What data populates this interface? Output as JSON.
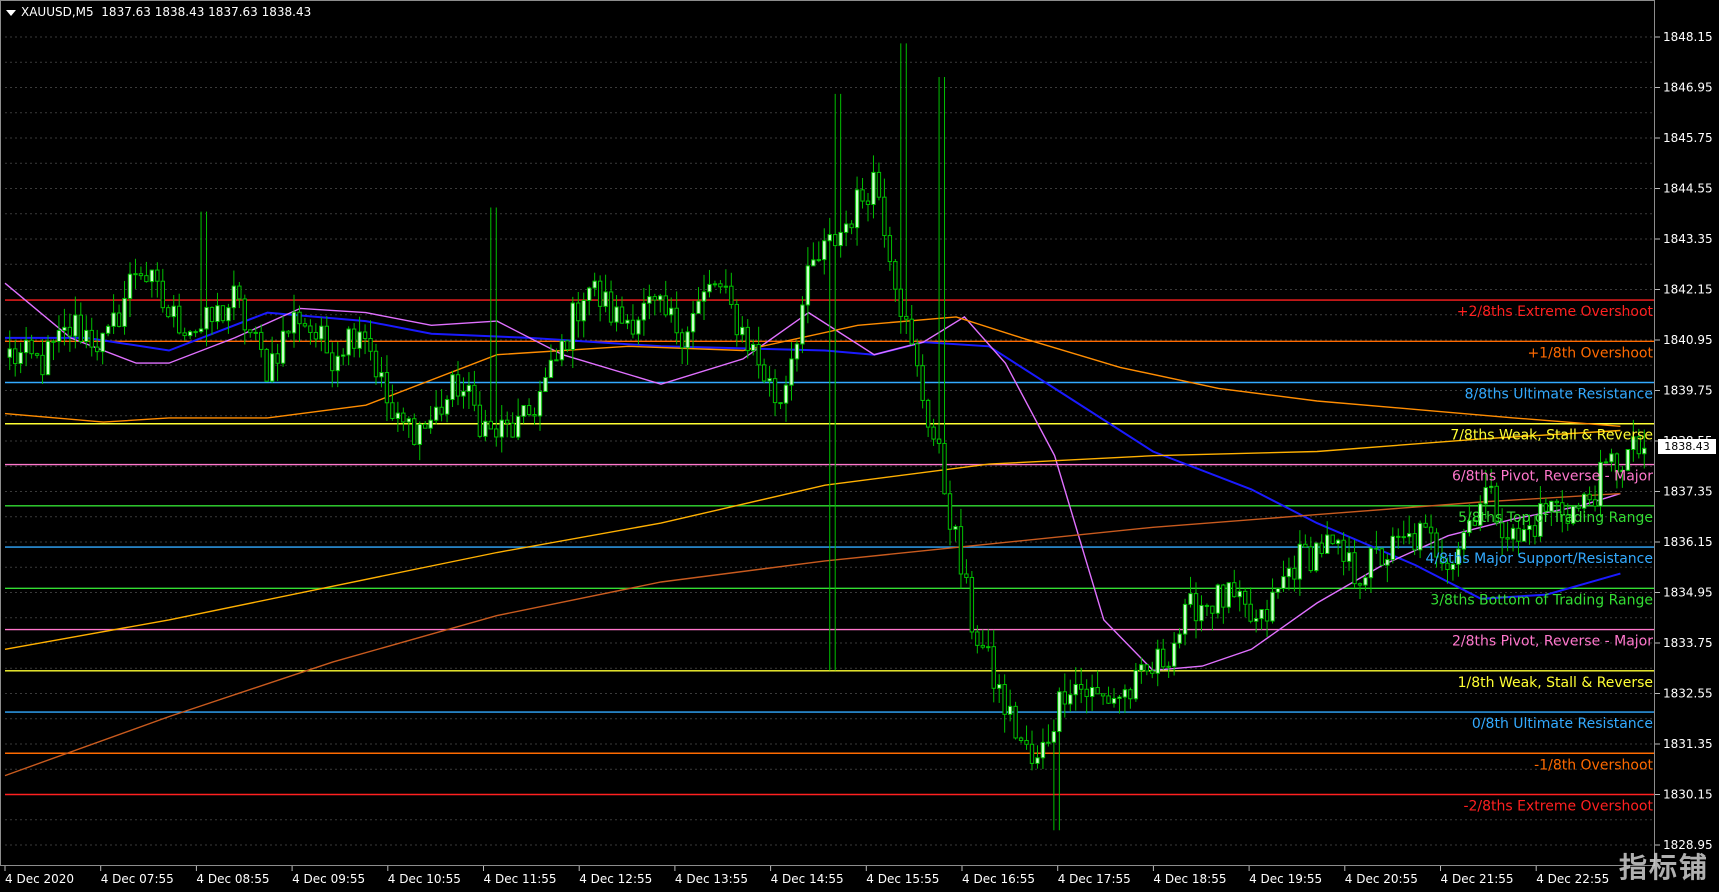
{
  "header": {
    "symbol": "XAUUSD,M5",
    "ohlc": "1837.63 1838.43 1837.63 1838.43"
  },
  "current_price_label": "1838.43",
  "watermark_text": "指标铺",
  "colors": {
    "background": "#000000",
    "bull_candle": "#ccffcc",
    "bear_candle": "#000000",
    "wick": "#00c000",
    "ma_blue": "#1a1aff",
    "ma_violet": "#e070ff",
    "ma_orange": "#ff8c00",
    "ma_gold": "#ffb000",
    "ma_brown": "#c85a1e"
  },
  "chart_data": {
    "type": "candlestick",
    "price_axis": {
      "ylim": [
        1828.95,
        1848.15
      ],
      "ticks": [
        "1848.15",
        "1846.95",
        "1845.75",
        "1844.55",
        "1843.35",
        "1842.15",
        "1840.95",
        "1839.75",
        "1838.55",
        "1837.35",
        "1836.15",
        "1834.95",
        "1833.75",
        "1832.55",
        "1831.35",
        "1830.15",
        "1828.95"
      ]
    },
    "time_axis": {
      "labels": [
        "4 Dec 2020",
        "4 Dec 07:55",
        "4 Dec 08:55",
        "4 Dec 09:55",
        "4 Dec 10:55",
        "4 Dec 11:55",
        "4 Dec 12:55",
        "4 Dec 13:55",
        "4 Dec 14:55",
        "4 Dec 15:55",
        "4 Dec 16:55",
        "4 Dec 17:55",
        "4 Dec 18:55",
        "4 Dec 19:55",
        "4 Dec 20:55",
        "4 Dec 21:55",
        "4 Dec 22:55"
      ]
    },
    "murrey_levels": [
      {
        "label": "+2/8ths Extreme Overshoot",
        "price": 1841.9,
        "color": "#ff2020"
      },
      {
        "label": "+1/8th Overshoot",
        "price": 1840.92,
        "color": "#ff6a00"
      },
      {
        "label": "8/8ths Ultimate Resistance",
        "price": 1839.94,
        "color": "#33aaff"
      },
      {
        "label": "7/8ths Weak, Stall & Reverse",
        "price": 1838.96,
        "color": "#ffff33"
      },
      {
        "label": "6/8ths Pivot, Reverse - Major",
        "price": 1837.99,
        "color": "#ff77cc"
      },
      {
        "label": "5/8ths Top of Trading Range",
        "price": 1837.01,
        "color": "#33dd33"
      },
      {
        "label": "4/8ths Major Support/Resistance",
        "price": 1836.03,
        "color": "#33aaff"
      },
      {
        "label": "3/8ths Bottom of Trading Range",
        "price": 1835.05,
        "color": "#33dd33"
      },
      {
        "label": "2/8ths Pivot, Reverse - Major",
        "price": 1834.07,
        "color": "#ff77cc"
      },
      {
        "label": "1/8th Weak, Stall & Reverse",
        "price": 1833.09,
        "color": "#ffff33"
      },
      {
        "label": "0/8th Ultimate Resistance",
        "price": 1832.11,
        "color": "#33aaff"
      },
      {
        "label": "-1/8th Overshoot",
        "price": 1831.13,
        "color": "#ff6a00"
      },
      {
        "label": "-2/8ths Extreme Overshoot",
        "price": 1830.15,
        "color": "#ff2020"
      }
    ],
    "anchors": [
      1840.6,
      1840.4,
      1841.3,
      1840.8,
      1842.8,
      1841.5,
      1841.2,
      1841.9,
      1840.3,
      1841.6,
      1840.6,
      1841.4,
      1838.9,
      1838.9,
      1839.9,
      1838.7,
      1838.9,
      1840.3,
      1842.3,
      1841.4,
      1841.7,
      1841.2,
      1842.3,
      1841.0,
      1839.4,
      1842.6,
      1843.6,
      1844.9,
      1841.1,
      1838.1,
      1834.3,
      1832.3,
      1830.7,
      1832.9,
      1832.4,
      1832.6,
      1833.4,
      1834.7,
      1834.8,
      1834.1,
      1835.6,
      1836.1,
      1835.4,
      1835.9,
      1836.3,
      1835.8,
      1837.4,
      1836.1,
      1837.0,
      1836.9,
      1838.0,
      1838.4
    ],
    "extremes": [
      {
        "t": 0.502,
        "low": 1833.1
      },
      {
        "t": 0.506,
        "high": 1846.8
      },
      {
        "t": 0.547,
        "high": 1848.0
      },
      {
        "t": 0.571,
        "high": 1847.2
      },
      {
        "t": 0.64,
        "low": 1829.3
      },
      {
        "t": 0.296,
        "high": 1844.1
      },
      {
        "t": 0.12,
        "high": 1844.0
      }
    ],
    "moving_averages": [
      {
        "key": "blue",
        "points": [
          [
            0,
            1841.0
          ],
          [
            0.05,
            1841.0
          ],
          [
            0.1,
            1840.7
          ],
          [
            0.16,
            1841.6
          ],
          [
            0.22,
            1841.4
          ],
          [
            0.26,
            1841.1
          ],
          [
            0.32,
            1841.0
          ],
          [
            0.4,
            1840.8
          ],
          [
            0.5,
            1840.7
          ],
          [
            0.53,
            1840.6
          ],
          [
            0.56,
            1840.9
          ],
          [
            0.6,
            1840.8
          ],
          [
            0.64,
            1839.8
          ],
          [
            0.7,
            1838.3
          ],
          [
            0.76,
            1837.4
          ],
          [
            0.8,
            1836.6
          ],
          [
            0.86,
            1835.6
          ],
          [
            0.9,
            1834.8
          ],
          [
            0.94,
            1834.9
          ],
          [
            0.985,
            1835.4
          ]
        ]
      },
      {
        "key": "violet",
        "points": [
          [
            0,
            1842.3
          ],
          [
            0.04,
            1841.0
          ],
          [
            0.08,
            1840.4
          ],
          [
            0.1,
            1840.4
          ],
          [
            0.14,
            1841.0
          ],
          [
            0.18,
            1841.7
          ],
          [
            0.22,
            1841.6
          ],
          [
            0.26,
            1841.3
          ],
          [
            0.3,
            1841.4
          ],
          [
            0.34,
            1840.6
          ],
          [
            0.4,
            1839.9
          ],
          [
            0.45,
            1840.5
          ],
          [
            0.49,
            1841.6
          ],
          [
            0.53,
            1840.6
          ],
          [
            0.56,
            1840.9
          ],
          [
            0.585,
            1841.5
          ],
          [
            0.61,
            1840.4
          ],
          [
            0.64,
            1838.2
          ],
          [
            0.67,
            1834.3
          ],
          [
            0.7,
            1833.1
          ],
          [
            0.73,
            1833.2
          ],
          [
            0.76,
            1833.6
          ],
          [
            0.8,
            1834.7
          ],
          [
            0.84,
            1835.6
          ],
          [
            0.88,
            1836.3
          ],
          [
            0.92,
            1836.7
          ],
          [
            0.96,
            1837.0
          ],
          [
            0.985,
            1837.3
          ]
        ]
      },
      {
        "key": "orange",
        "points": [
          [
            0,
            1839.2
          ],
          [
            0.06,
            1839.0
          ],
          [
            0.1,
            1839.1
          ],
          [
            0.16,
            1839.1
          ],
          [
            0.22,
            1839.4
          ],
          [
            0.3,
            1840.6
          ],
          [
            0.38,
            1840.8
          ],
          [
            0.45,
            1840.7
          ],
          [
            0.52,
            1841.3
          ],
          [
            0.58,
            1841.5
          ],
          [
            0.62,
            1841.0
          ],
          [
            0.68,
            1840.3
          ],
          [
            0.74,
            1839.8
          ],
          [
            0.8,
            1839.5
          ],
          [
            0.86,
            1839.3
          ],
          [
            0.92,
            1839.1
          ],
          [
            0.985,
            1838.9
          ]
        ]
      },
      {
        "key": "gold",
        "points": [
          [
            0,
            1833.6
          ],
          [
            0.1,
            1834.3
          ],
          [
            0.2,
            1835.1
          ],
          [
            0.3,
            1835.9
          ],
          [
            0.4,
            1836.6
          ],
          [
            0.5,
            1837.5
          ],
          [
            0.6,
            1838.0
          ],
          [
            0.7,
            1838.2
          ],
          [
            0.8,
            1838.3
          ],
          [
            0.9,
            1838.6
          ],
          [
            0.985,
            1838.8
          ]
        ]
      },
      {
        "key": "brown",
        "points": [
          [
            0,
            1830.6
          ],
          [
            0.1,
            1832.0
          ],
          [
            0.2,
            1833.3
          ],
          [
            0.3,
            1834.4
          ],
          [
            0.4,
            1835.2
          ],
          [
            0.5,
            1835.7
          ],
          [
            0.6,
            1836.1
          ],
          [
            0.7,
            1836.5
          ],
          [
            0.8,
            1836.8
          ],
          [
            0.9,
            1837.1
          ],
          [
            0.985,
            1837.3
          ]
        ]
      }
    ]
  }
}
